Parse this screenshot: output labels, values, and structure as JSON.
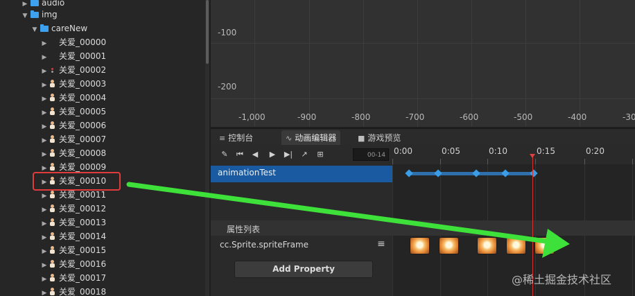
{
  "tree": {
    "folders": [
      {
        "name": "audio",
        "expanded": false
      },
      {
        "name": "img",
        "expanded": true
      },
      {
        "name": "careNew",
        "expanded": true
      }
    ],
    "sprites": [
      "关爱_00000",
      "关爱_00001",
      "关爱_00002",
      "关爱_00003",
      "关爱_00004",
      "关爱_00005",
      "关爱_00006",
      "关爱_00007",
      "关爱_00008",
      "关爱_00009",
      "关爱_00010",
      "关爱_00011",
      "关爱_00012",
      "关爱_00013",
      "关爱_00014",
      "关爱_00015",
      "关爱_00016",
      "关爱_00017",
      "关爱_00018"
    ],
    "highlighted_sprite": "关爱_00010"
  },
  "scene": {
    "y_labels": [
      "-100",
      "-200"
    ],
    "x_labels": [
      "-1,000",
      "-900",
      "-800",
      "-700",
      "-600",
      "-500",
      "-400",
      "-30"
    ]
  },
  "tabs": [
    {
      "label": "控制台",
      "icon": "console-icon"
    },
    {
      "label": "动画编辑器",
      "icon": "animation-icon",
      "active": true
    },
    {
      "label": "游戏预览",
      "icon": "camera-icon"
    }
  ],
  "animation": {
    "timecode": "00-14",
    "ruler": [
      "0:00",
      "0:05",
      "0:10",
      "0:15",
      "0:20"
    ],
    "node_name": "animationTest",
    "keyframe_count": 5,
    "properties_header": "属性列表",
    "property_name": "cc.Sprite.spriteFrame",
    "add_property_label": "Add Property",
    "sprite_frame_count": 5
  },
  "watermark": "@稀土掘金技术社区",
  "colors": {
    "highlight_box": "#e23b3b",
    "arrow": "#3ee03a",
    "keyframe": "#3a9de6",
    "playhead": "#d8312f",
    "selected_row": "#1a5aa0"
  }
}
